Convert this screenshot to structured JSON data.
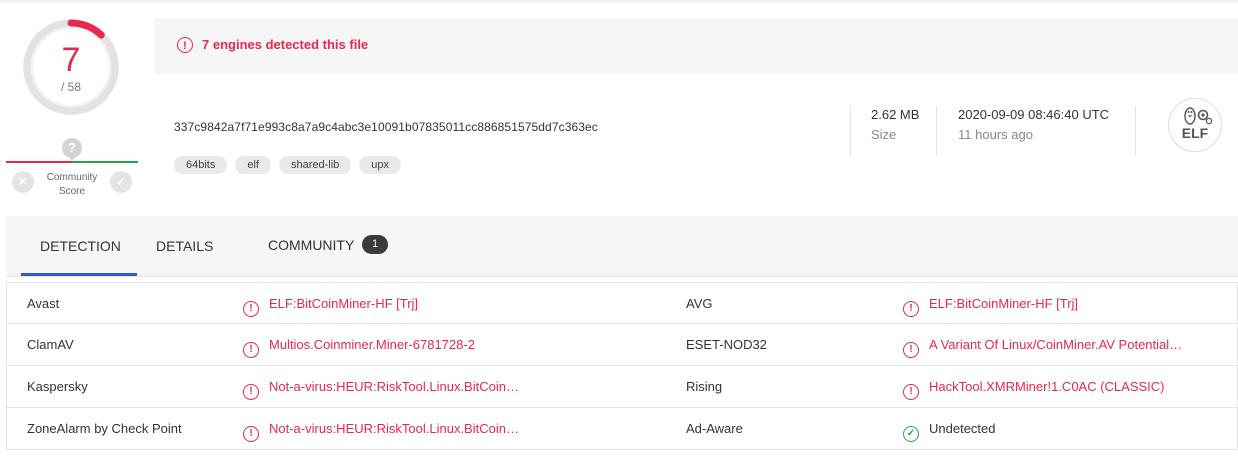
{
  "score": {
    "detected": "7",
    "total": "/ 58",
    "fraction": 0.1207
  },
  "community": {
    "question": "?",
    "label_line1": "Community",
    "label_line2": "Score",
    "dislike": "✕",
    "like": "✓"
  },
  "banner": {
    "icon": "!",
    "text": "7 engines detected this file"
  },
  "file": {
    "hash": "337c9842a7f71e993c8a7a9c4abc3e10091b07835011cc886851575dd7c363ec",
    "tags": [
      "64bits",
      "elf",
      "shared-lib",
      "upx"
    ],
    "size_value": "2.62 MB",
    "size_label": "Size",
    "date_value": "2020-09-09 08:46:40 UTC",
    "date_ago": "11 hours ago",
    "type_icon_label": "ELF"
  },
  "tabs": {
    "detection": "DETECTION",
    "details": "DETAILS",
    "community": "COMMUNITY",
    "community_count": "1"
  },
  "detections": [
    {
      "engine1": "Avast",
      "result1": "ELF:BitCoinMiner-HF [Trj]",
      "engine2": "AVG",
      "result2": "ELF:BitCoinMiner-HF [Trj]"
    },
    {
      "engine1": "ClamAV",
      "result1": "Multios.Coinminer.Miner-6781728-2",
      "engine2": "ESET-NOD32",
      "result2": "A Variant Of Linux/CoinMiner.AV Potential…"
    },
    {
      "engine1": "Kaspersky",
      "result1": "Not-a-virus:HEUR:RiskTool.Linux.BitCoin…",
      "engine2": "Rising",
      "result2": "HackTool.XMRMiner!1.C0AC (CLASSIC)"
    },
    {
      "engine1": "ZoneAlarm by Check Point",
      "result1": "Not-a-virus:HEUR:RiskTool.Linux.BitCoin…",
      "engine2": "Ad-Aware",
      "result2": "Undetected"
    }
  ],
  "icons": {
    "alert": "!",
    "ok": "✓"
  },
  "colors": {
    "danger": "#e8284f",
    "ok": "#29a744",
    "accent": "#2f5acb"
  }
}
